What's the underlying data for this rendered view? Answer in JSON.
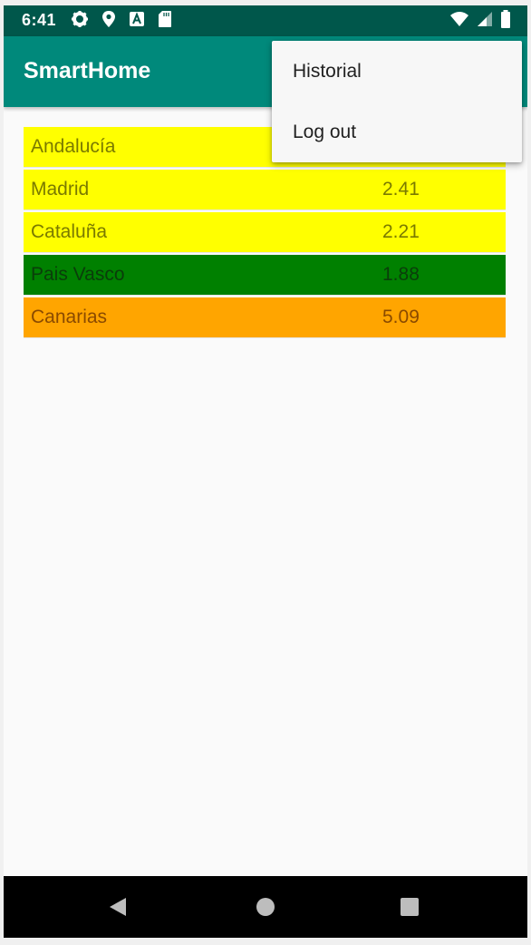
{
  "status_bar": {
    "time": "6:41",
    "left_icons": [
      "gear-icon",
      "location-icon",
      "a-letter-icon",
      "sd-card-icon"
    ],
    "right_icons": [
      "wifi-icon",
      "signal-icon",
      "battery-icon"
    ]
  },
  "app_bar": {
    "title": "SmartHome"
  },
  "table": {
    "rows": [
      {
        "region": "Andalucía",
        "value": "",
        "bg": "#ffff00",
        "color": "#7a7a00"
      },
      {
        "region": "Madrid",
        "value": "2.41",
        "bg": "#ffff00",
        "color": "#7a7a00"
      },
      {
        "region": "Cataluña",
        "value": "2.21",
        "bg": "#ffff00",
        "color": "#7a7a00"
      },
      {
        "region": "Pais Vasco",
        "value": "1.88",
        "bg": "#008000",
        "color": "#0a3d0a"
      },
      {
        "region": "Canarias",
        "value": "5.09",
        "bg": "#ffa500",
        "color": "#8a4a00"
      }
    ]
  },
  "menu": {
    "items": [
      {
        "label": "Historial"
      },
      {
        "label": "Log out"
      }
    ]
  },
  "nav_bar": {
    "buttons": [
      "back-icon",
      "home-icon",
      "recents-icon"
    ]
  }
}
